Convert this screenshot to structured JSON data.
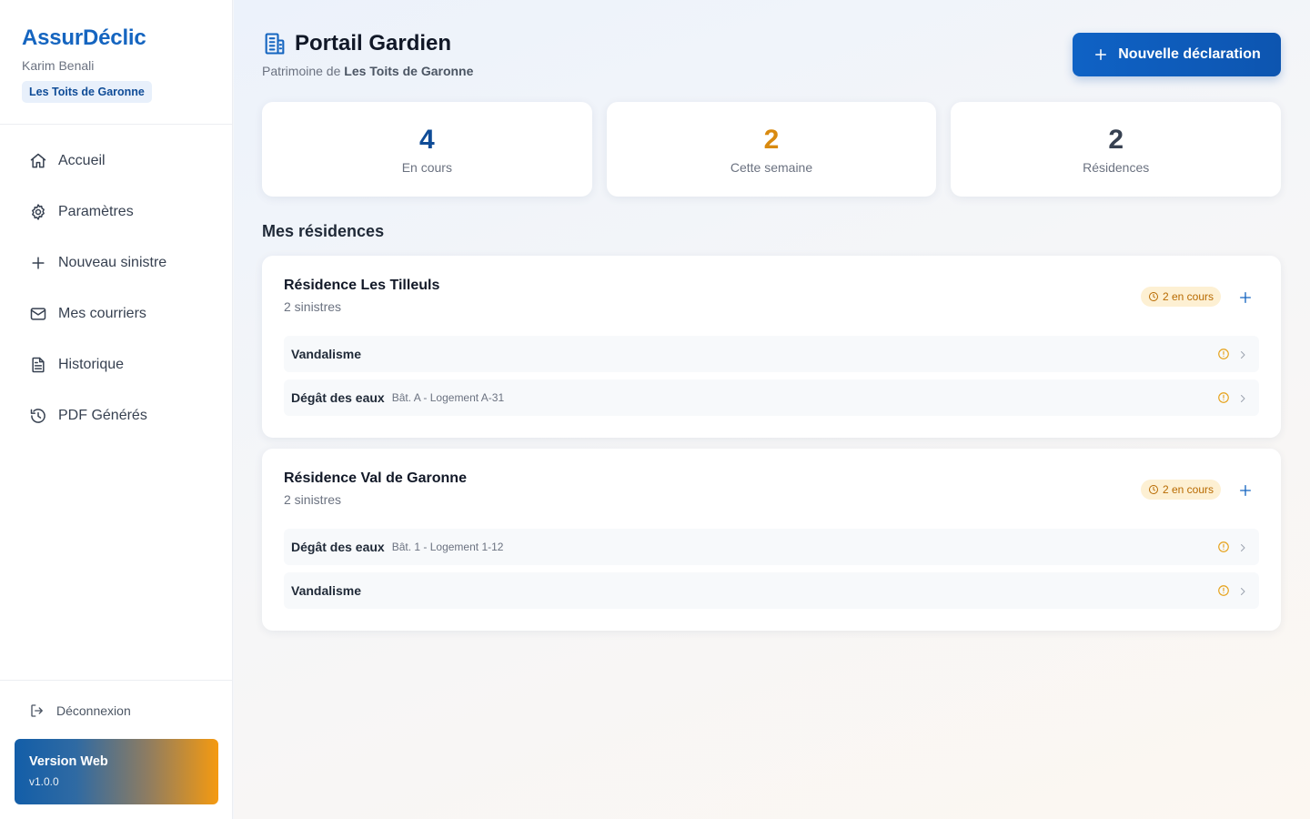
{
  "brand": {
    "name": "AssurDéclic",
    "user": "Karim Benali",
    "org": "Les Toits de Garonne"
  },
  "nav": [
    {
      "label": "Accueil",
      "icon": "home-icon"
    },
    {
      "label": "Paramètres",
      "icon": "gear-icon"
    },
    {
      "label": "Nouveau sinistre",
      "icon": "plus-icon"
    },
    {
      "label": "Mes courriers",
      "icon": "mail-icon"
    },
    {
      "label": "Historique",
      "icon": "document-icon"
    },
    {
      "label": "PDF Générés",
      "icon": "history-icon"
    }
  ],
  "sidebar_bottom": {
    "logout_label": "Déconnexion",
    "version_title": "Version Web",
    "version_number": "v1.0.0"
  },
  "header": {
    "title": "Portail Gardien",
    "subtitle_prefix": "Patrimoine de ",
    "subtitle_org": "Les Toits de Garonne",
    "new_button_label": "Nouvelle déclaration"
  },
  "stats": [
    {
      "value": "4",
      "label": "En cours",
      "color": "#0f4c97"
    },
    {
      "value": "2",
      "label": "Cette semaine",
      "color": "#d98a10"
    },
    {
      "value": "2",
      "label": "Résidences",
      "color": "#374151"
    }
  ],
  "section_title": "Mes résidences",
  "residences": [
    {
      "name": "Résidence Les Tilleuls",
      "count": "2 sinistres",
      "badge": "2 en cours",
      "claims": [
        {
          "type": "Vandalisme",
          "location": ""
        },
        {
          "type": "Dégât des eaux",
          "location": "Bât. A - Logement A-31"
        }
      ]
    },
    {
      "name": "Résidence Val de Garonne",
      "count": "2 sinistres",
      "badge": "2 en cours",
      "claims": [
        {
          "type": "Dégât des eaux",
          "location": "Bât. 1 - Logement 1-12"
        },
        {
          "type": "Vandalisme",
          "location": ""
        }
      ]
    }
  ],
  "colors": {
    "accent": "#1565c0",
    "warning": "#e6a21a"
  }
}
